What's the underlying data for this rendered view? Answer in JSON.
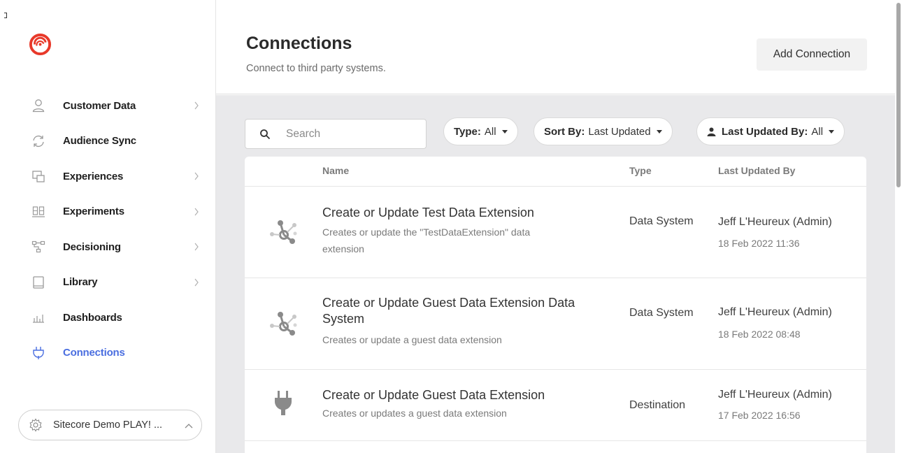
{
  "sidebar": {
    "items": [
      {
        "label": "Customer Data",
        "icon": "person-icon",
        "has_chevron": true
      },
      {
        "label": "Audience Sync",
        "icon": "sync-icon",
        "has_chevron": false
      },
      {
        "label": "Experiences",
        "icon": "experiences-icon",
        "has_chevron": true
      },
      {
        "label": "Experiments",
        "icon": "experiments-icon",
        "has_chevron": true
      },
      {
        "label": "Decisioning",
        "icon": "decisioning-icon",
        "has_chevron": true
      },
      {
        "label": "Library",
        "icon": "library-icon",
        "has_chevron": true
      },
      {
        "label": "Dashboards",
        "icon": "dashboards-icon",
        "has_chevron": false
      },
      {
        "label": "Connections",
        "icon": "plug-icon",
        "has_chevron": false,
        "active": true
      }
    ],
    "org_switcher": {
      "label": "Sitecore Demo PLAY! ..."
    }
  },
  "header": {
    "title": "Connections",
    "subtitle": "Connect to third party systems.",
    "add_button": "Add Connection"
  },
  "filters": {
    "search_placeholder": "Search",
    "type": {
      "key": "Type:",
      "value": "All"
    },
    "sort": {
      "key": "Sort By:",
      "value": "Last Updated"
    },
    "updated_by": {
      "key": "Last Updated By:",
      "value": "All"
    }
  },
  "table": {
    "columns": [
      "Name",
      "Type",
      "Last Updated By"
    ],
    "rows": [
      {
        "name": "Create or Update Test Data Extension",
        "description": "Creates or update the \"TestDataExtension\" data extension",
        "type": "Data System",
        "updated_by": "Jeff L'Heureux (Admin)",
        "date": "18 Feb 2022 11:36",
        "icon": "data-system-icon"
      },
      {
        "name": "Create or Update Guest Data Extension Data System",
        "description": "Creates or update a guest data extension",
        "type": "Data System",
        "updated_by": "Jeff L'Heureux (Admin)",
        "date": "18 Feb 2022 08:48",
        "icon": "data-system-icon"
      },
      {
        "name": "Create or Update Guest Data Extension",
        "description": "Creates or updates a guest data extension",
        "type": "Destination",
        "updated_by": "Jeff L'Heureux (Admin)",
        "date": "17 Feb 2022 16:56",
        "icon": "plug-icon"
      }
    ]
  },
  "colors": {
    "accent": "#4a6ee0",
    "logo": "#e8392a",
    "content_bg": "#e9e9eb"
  }
}
